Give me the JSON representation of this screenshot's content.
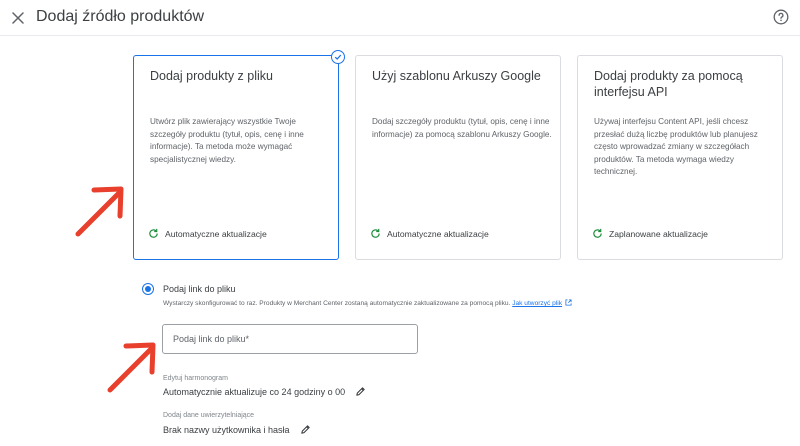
{
  "header": {
    "title": "Dodaj źródło produktów",
    "close_icon": "close-icon",
    "help_icon": "help-circle-icon"
  },
  "cards": [
    {
      "title": "Dodaj produkty z pliku",
      "description": "Utwórz plik zawierający wszystkie Twoje szczegóły produktu (tytuł, opis, cenę i inne informacje). Ta metoda może wymagać specjalistycznej wiedzy.",
      "footer": "Automatyczne aktualizacje",
      "selected": true
    },
    {
      "title": "Użyj szablonu Arkuszy Google",
      "description": "Dodaj szczegóły produktu (tytuł, opis, cenę i inne informacje) za pomocą szablonu Arkuszy Google.",
      "footer": "Automatyczne aktualizacje",
      "selected": false
    },
    {
      "title": "Dodaj produkty za pomocą interfejsu API",
      "description": "Używaj interfejsu Content API, jeśli chcesz przesłać dużą liczbę produktów lub planujesz często wprowadzać zmiany w szczegółach produktów. Ta metoda wymaga wiedzy technicznej.",
      "footer": "Zaplanowane aktualizacje",
      "selected": false
    }
  ],
  "link_option": {
    "label": "Podaj link do pliku",
    "help_text": "Wystarczy skonfigurować to raz. Produkty w Merchant Center zostaną automatycznie zaktualizowane za pomocą pliku.",
    "help_link": "Jak utworzyć plik",
    "input_placeholder": "Podaj link do pliku*",
    "input_value": ""
  },
  "schedule": {
    "label": "Edytuj harmonogram",
    "value": "Automatycznie aktualizuje co 24 godziny o 00"
  },
  "credentials": {
    "label": "Dodaj dane uwierzytelniające",
    "value": "Brak nazwy użytkownika i hasła"
  },
  "colors": {
    "accent": "#1a73e8",
    "annotation_arrow": "#e8402c",
    "border": "#dadce0",
    "refresh_icon": "#1e8e3e"
  }
}
